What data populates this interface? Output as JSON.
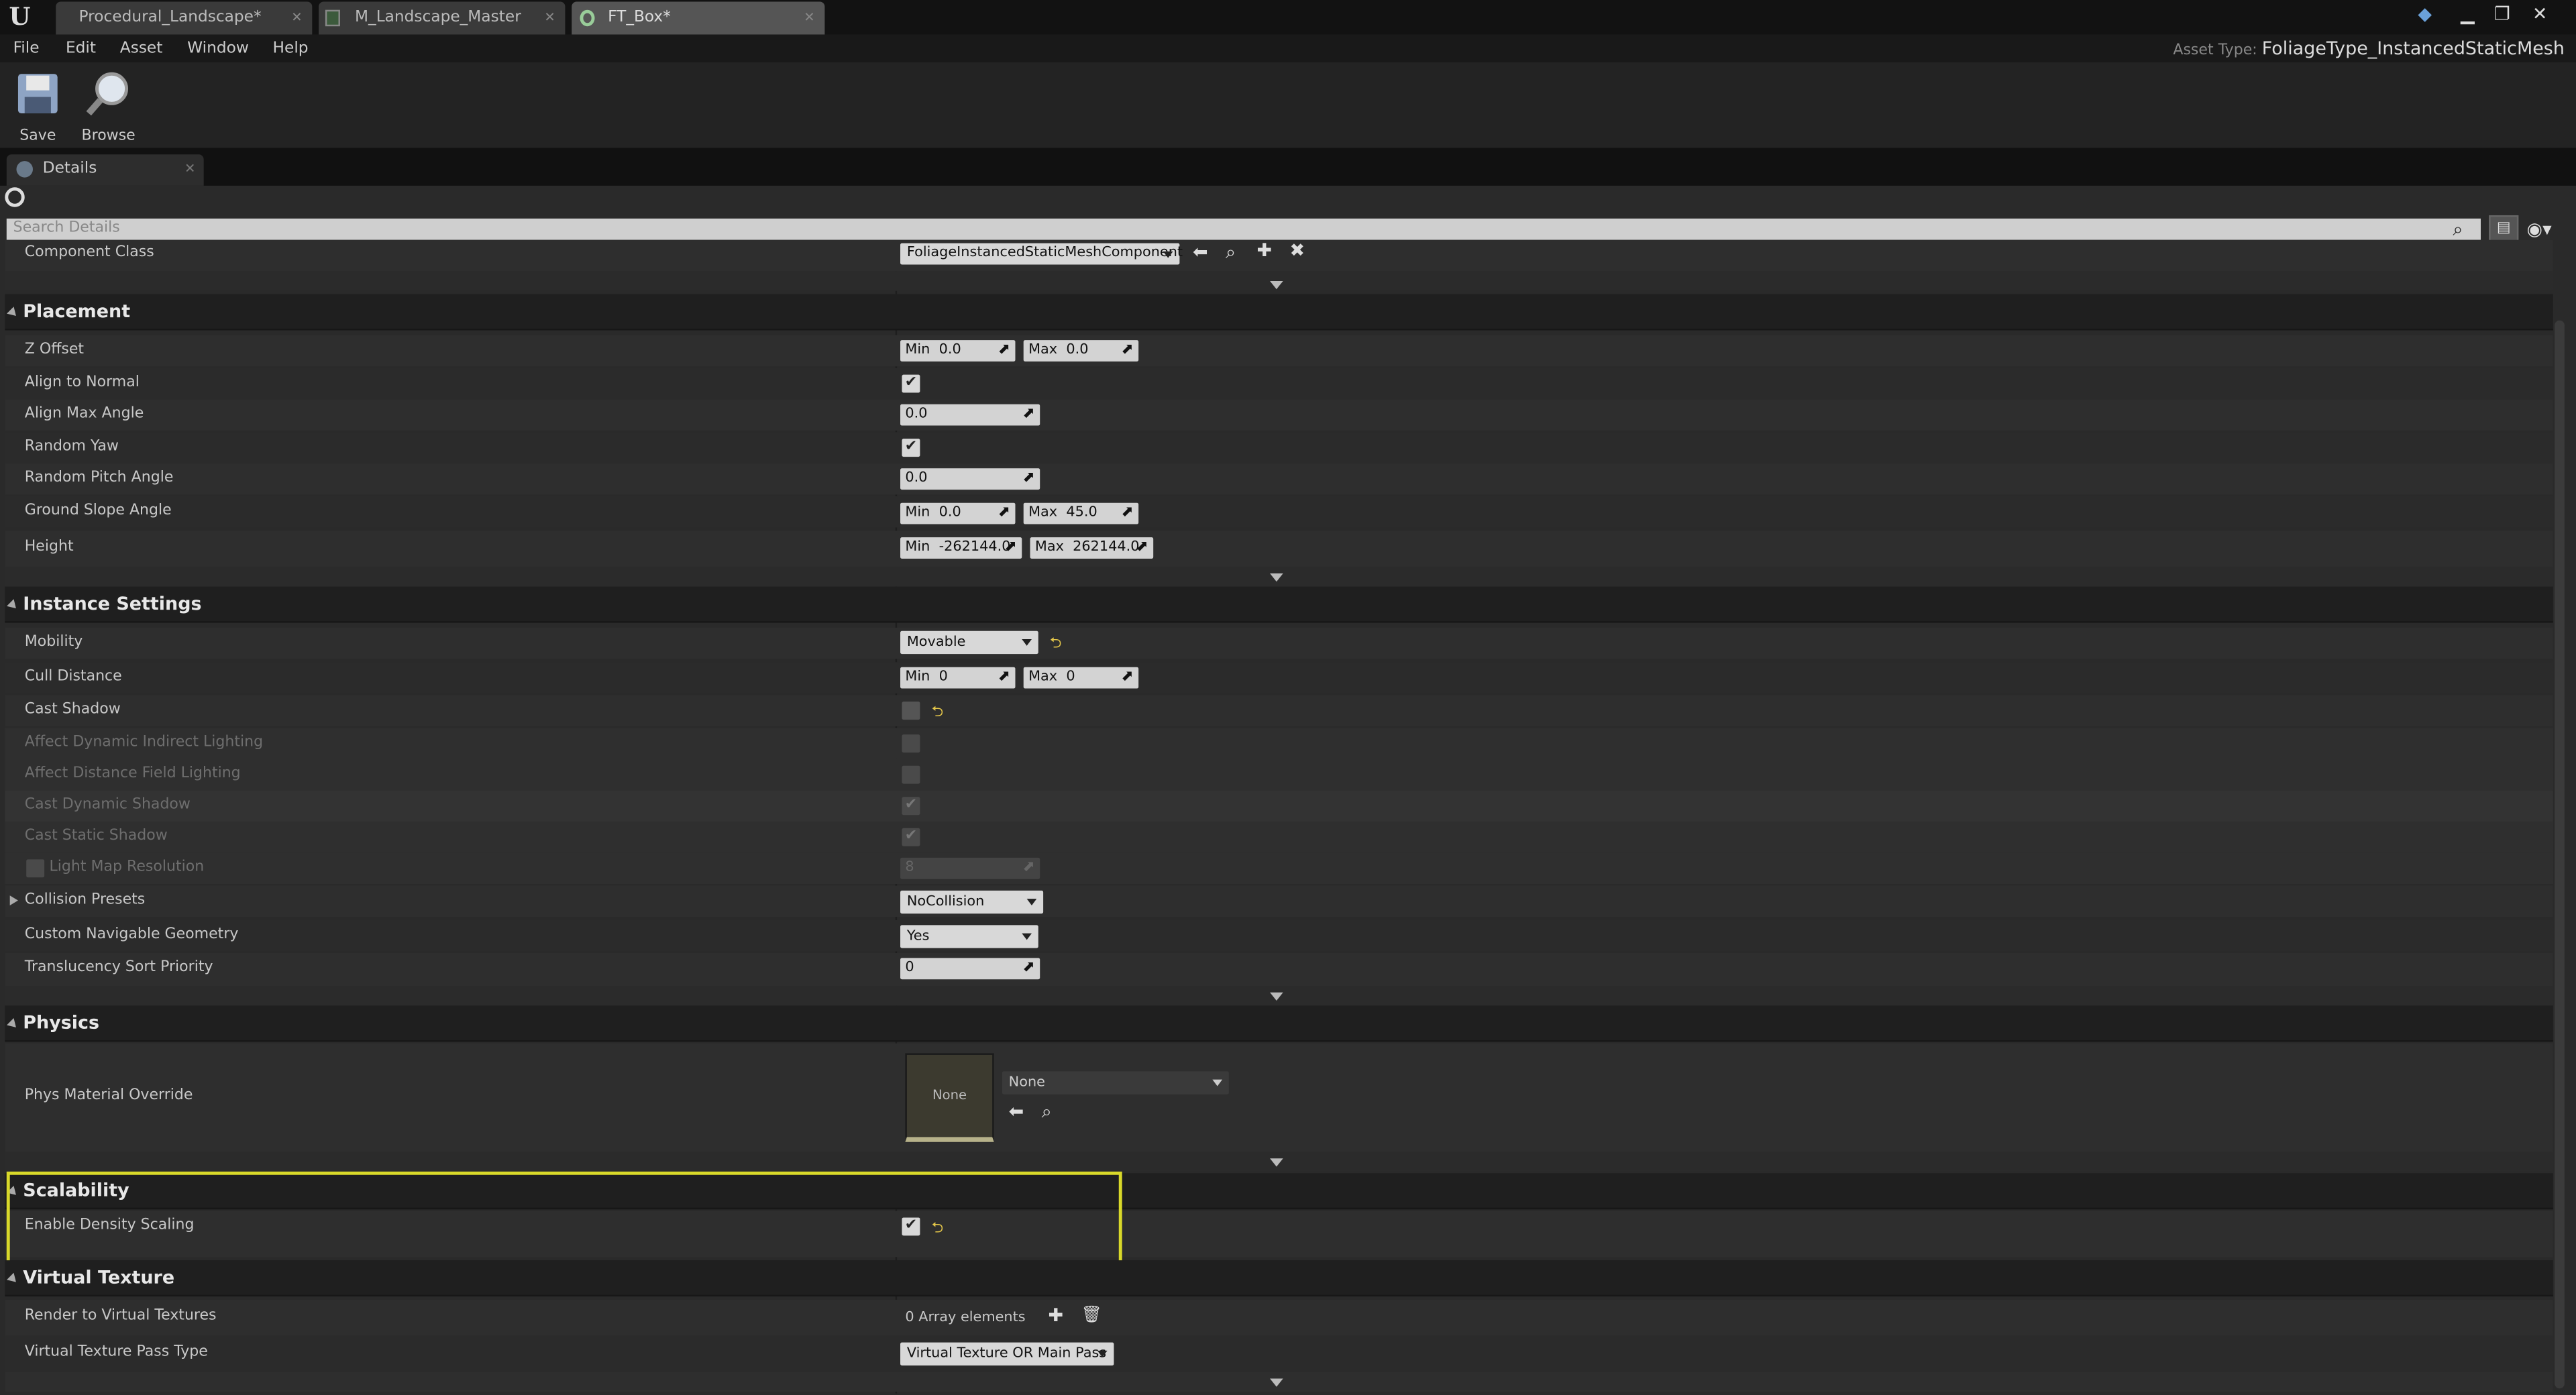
{
  "tabs": [
    {
      "label": "Procedural_Landscape*"
    },
    {
      "label": "M_Landscape_Master"
    },
    {
      "label": "FT_Box*"
    }
  ],
  "menu": [
    "File",
    "Edit",
    "Asset",
    "Window",
    "Help"
  ],
  "asset_type": {
    "label": "Asset Type:",
    "value": "FoliageType_InstancedStaticMesh"
  },
  "toolbar": {
    "save": "Save",
    "browse": "Browse"
  },
  "details_tab": "Details",
  "search": {
    "placeholder": "Search Details"
  },
  "component_class": {
    "label": "Component Class",
    "value": "FoliageInstancedStaticMeshComponent"
  },
  "placement": {
    "title": "Placement",
    "z_offset": {
      "label": "Z Offset",
      "min_label": "Min",
      "min": "0.0",
      "max_label": "Max",
      "max": "0.0"
    },
    "align_to_normal": {
      "label": "Align to Normal",
      "checked": true
    },
    "align_max_angle": {
      "label": "Align Max Angle",
      "value": "0.0"
    },
    "random_yaw": {
      "label": "Random Yaw",
      "checked": true
    },
    "random_pitch": {
      "label": "Random Pitch Angle",
      "value": "0.0"
    },
    "ground_slope": {
      "label": "Ground Slope Angle",
      "min_label": "Min",
      "min": "0.0",
      "max_label": "Max",
      "max": "45.0"
    },
    "height": {
      "label": "Height",
      "min_label": "Min",
      "min": "-262144.0",
      "max_label": "Max",
      "max": "262144.0"
    }
  },
  "instance": {
    "title": "Instance Settings",
    "mobility": {
      "label": "Mobility",
      "value": "Movable"
    },
    "cull": {
      "label": "Cull Distance",
      "min_label": "Min",
      "min": "0",
      "max_label": "Max",
      "max": "0"
    },
    "cast_shadow": {
      "label": "Cast Shadow",
      "checked": false
    },
    "affect_indirect": {
      "label": "Affect Dynamic Indirect Lighting"
    },
    "affect_df": {
      "label": "Affect Distance Field Lighting"
    },
    "cast_dynamic": {
      "label": "Cast Dynamic Shadow"
    },
    "cast_static": {
      "label": "Cast Static Shadow"
    },
    "lightmap": {
      "label": "Light Map Resolution",
      "value": "8"
    },
    "collision": {
      "label": "Collision Presets",
      "value": "NoCollision"
    },
    "nav": {
      "label": "Custom Navigable Geometry",
      "value": "Yes"
    },
    "translucency": {
      "label": "Translucency Sort Priority",
      "value": "0"
    }
  },
  "physics": {
    "title": "Physics",
    "phys_material": {
      "label": "Phys Material Override",
      "thumb": "None",
      "value": "None"
    }
  },
  "scalability": {
    "title": "Scalability",
    "density": {
      "label": "Enable Density Scaling",
      "checked": true
    }
  },
  "virtual_texture": {
    "title": "Virtual Texture",
    "render": {
      "label": "Render to Virtual Textures",
      "value": "0 Array elements"
    },
    "pass_type": {
      "label": "Virtual Texture Pass Type",
      "value": "Virtual Texture OR Main Pass"
    }
  },
  "colors": {
    "highlight": "#d9d92a",
    "reset": "#e6c84a",
    "panel": "#2e2e2e"
  }
}
